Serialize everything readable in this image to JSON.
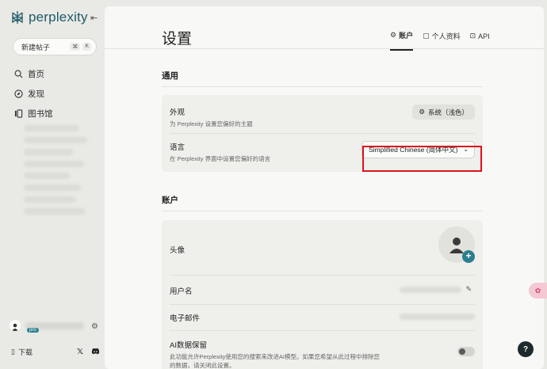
{
  "sidebar": {
    "logo_text": "perplexity",
    "new_thread_label": "新建帖子",
    "shortcut_keys": [
      "⌘",
      "K"
    ],
    "nav": [
      {
        "label": "首页",
        "icon": "search-icon"
      },
      {
        "label": "发现",
        "icon": "compass-icon"
      },
      {
        "label": "图书馆",
        "icon": "library-icon"
      }
    ],
    "pro_badge": "pro",
    "download_label": "下载"
  },
  "header": {
    "title": "设置",
    "tabs": [
      {
        "label": "账户",
        "icon": "gear-icon",
        "active": true
      },
      {
        "label": "个人资料",
        "icon": "profile-icon",
        "active": false
      },
      {
        "label": "API",
        "icon": "api-icon",
        "active": false
      }
    ]
  },
  "general": {
    "title": "通用",
    "appearance": {
      "title": "外观",
      "desc": "为 Perplexity 设置您偏好的主题",
      "value": "系统（浅色）"
    },
    "language": {
      "title": "语言",
      "desc": "在 Perplexity 界面中设置您偏好的语言",
      "value": "Simplified Chinese (简体中文)"
    }
  },
  "account": {
    "title": "账户",
    "avatar_label": "头像",
    "username_label": "用户名",
    "email_label": "电子邮件",
    "ai_retention": {
      "title": "AI数据保留",
      "desc_line1": "此功能允许Perplexity使用您的搜索来改进AI模型。如果您希望从此过程中排除您",
      "desc_line2": "的数据，请关闭此设置。"
    }
  },
  "help_label": "?",
  "colors": {
    "accent": "#2a7f8f",
    "highlight": "#e0121b",
    "logo": "#1e5b68"
  }
}
